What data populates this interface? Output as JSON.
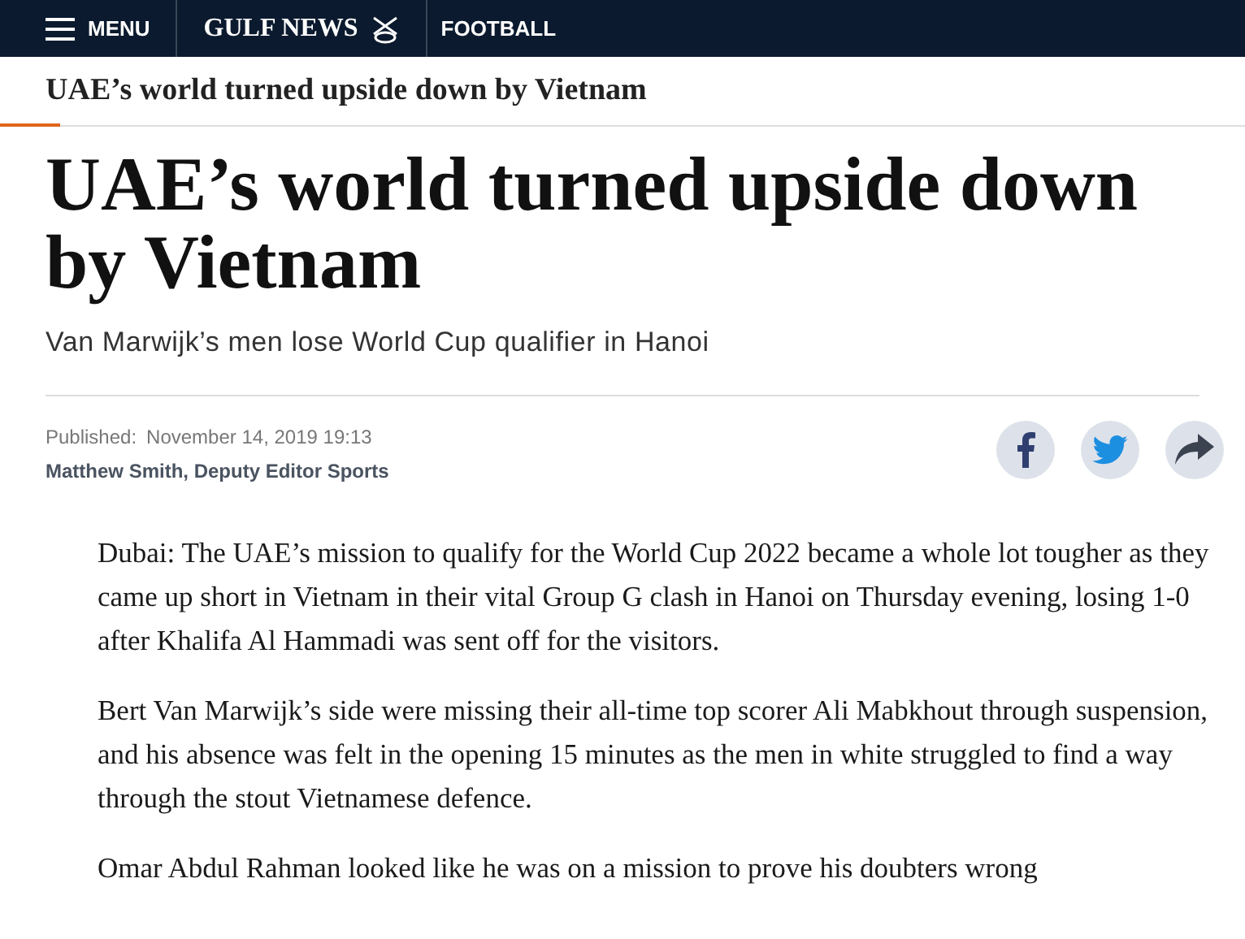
{
  "nav": {
    "menu": "MENU",
    "logo": "GULF NEWS",
    "section": "FOOTBALL"
  },
  "subheader": {
    "title": "UAE’s world turned upside down by Vietnam"
  },
  "article": {
    "headline": "UAE’s world turned upside down by Vietnam",
    "subtitle": "Van Marwijk’s men lose World Cup qualifier in Hanoi",
    "published_label": "Published:",
    "published_date": "November 14, 2019 19:13",
    "author": "Matthew Smith, Deputy Editor Sports",
    "share": [
      {
        "kind": "facebook"
      },
      {
        "kind": "twitter"
      },
      {
        "kind": "share"
      }
    ],
    "paragraphs": [
      "Dubai: The UAE’s mission to qualify for the World Cup 2022 became a whole lot tougher as they came up short in Vietnam in their vital Group G clash in Hanoi on Thursday evening, losing 1-0 after Khalifa Al Hammadi was sent off for the visitors.",
      "Bert Van Marwijk’s side were missing their all-time top scorer Ali Mabkhout through suspension, and his absence was felt in the opening 15 minutes as the men in white struggled to find a way through the stout Vietnamese defence.",
      "Omar Abdul Rahman looked like he was on a mission to prove his doubters wrong"
    ]
  }
}
